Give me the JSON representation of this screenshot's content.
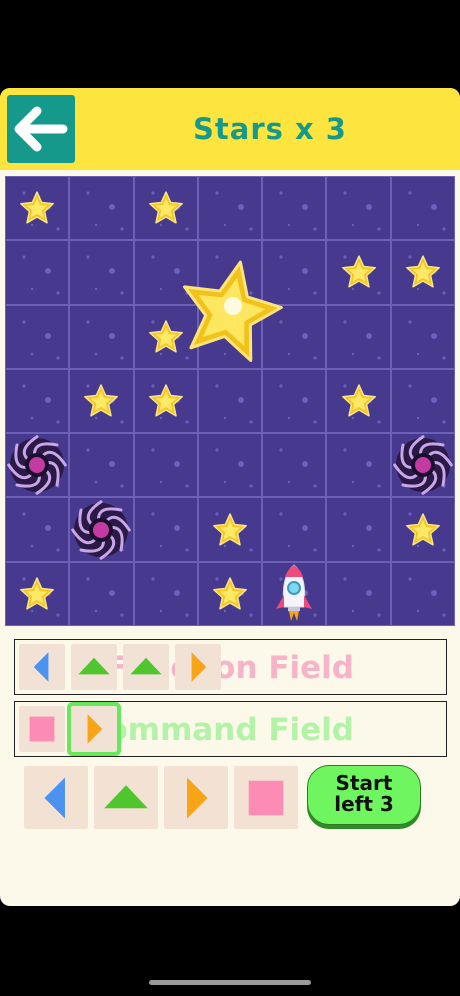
{
  "header": {
    "title": "Stars x 3",
    "back_icon": "left-arrow-icon",
    "colors": {
      "bar": "#fde43f",
      "back": "#15998a",
      "title": "#17998a"
    }
  },
  "board": {
    "rows": 7,
    "cols": 7,
    "colors": {
      "space": "#46398e",
      "grid": "#6c5fb8",
      "star": "#fbe04a"
    },
    "stars": [
      {
        "row": 0,
        "col": 0
      },
      {
        "row": 0,
        "col": 2
      },
      {
        "row": 1,
        "col": 5
      },
      {
        "row": 1,
        "col": 6
      },
      {
        "row": 2,
        "col": 2
      },
      {
        "row": 3,
        "col": 1
      },
      {
        "row": 3,
        "col": 2
      },
      {
        "row": 3,
        "col": 5
      },
      {
        "row": 5,
        "col": 3
      },
      {
        "row": 5,
        "col": 6
      },
      {
        "row": 6,
        "col": 0
      },
      {
        "row": 6,
        "col": 3
      }
    ],
    "big_star": {
      "row": 1.6,
      "col": 3.0
    },
    "black_holes": [
      {
        "row": 4,
        "col": 0
      },
      {
        "row": 4,
        "col": 6
      },
      {
        "row": 5,
        "col": 1
      }
    ],
    "rocket": {
      "row": 6,
      "col": 4
    }
  },
  "function_field": {
    "label": "Function Field",
    "label_color": "#f7b3c8",
    "slots": [
      "left-arrow-icon",
      "up-arrow-icon",
      "up-arrow-icon",
      "right-arrow-icon"
    ]
  },
  "command_field": {
    "label": "Command Field",
    "label_color": "#b3f3a6",
    "slots": [
      "stop-square-icon",
      "right-arrow-icon"
    ],
    "selected_slot": 1
  },
  "controls": {
    "buttons": [
      "left-arrow-icon",
      "up-arrow-icon",
      "right-arrow-icon",
      "stop-square-icon"
    ],
    "start_line1": "Start",
    "start_line2": "left 3"
  },
  "icon_colors": {
    "left": "#4b93f0",
    "up": "#4fc62e",
    "right": "#f9a316",
    "stop": "#fc8cb4"
  }
}
